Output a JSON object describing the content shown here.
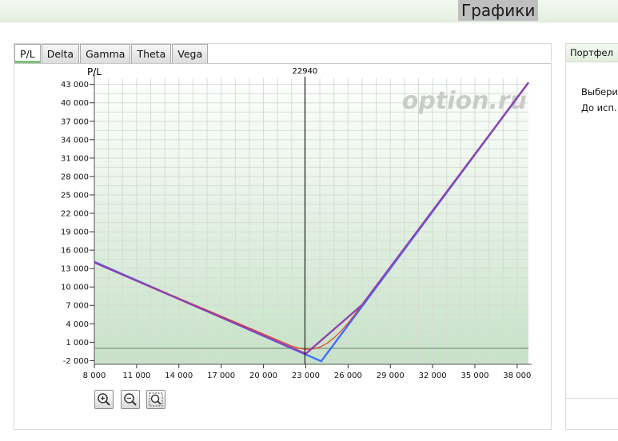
{
  "header": {
    "title": "Графики"
  },
  "tabs": [
    {
      "label": "P/L",
      "active": true
    },
    {
      "label": "Delta",
      "active": false
    },
    {
      "label": "Gamma",
      "active": false
    },
    {
      "label": "Theta",
      "active": false
    },
    {
      "label": "Vega",
      "active": false
    }
  ],
  "watermark": "option.ru",
  "zoom_buttons": [
    {
      "icon": "zoom-in-icon"
    },
    {
      "icon": "zoom-out-icon"
    },
    {
      "icon": "zoom-fit-icon"
    }
  ],
  "right_panel": {
    "header": "Портфел",
    "lines": [
      "Выбери",
      "До исп."
    ]
  },
  "colors": {
    "expiry_line": "#3f6fff",
    "today_line": "#8e44ad",
    "today_curve": "#e63b1f",
    "zero_line": "#7b8f7b",
    "marker_line": "#000000"
  },
  "chart_data": {
    "type": "line",
    "ylabel": "P/L",
    "marker": {
      "x": 22940,
      "label": "22940"
    },
    "xlim": [
      8000,
      38800
    ],
    "ylim": [
      -2600,
      44000
    ],
    "x_ticks": [
      8000,
      11000,
      14000,
      17000,
      20000,
      23000,
      26000,
      29000,
      32000,
      35000,
      38000
    ],
    "x_tick_labels": [
      "8 000",
      "11 000",
      "14 000",
      "17 000",
      "20 000",
      "23 000",
      "26 000",
      "29 000",
      "32 000",
      "35 000",
      "38 000"
    ],
    "y_ticks": [
      -2000,
      1000,
      4000,
      7000,
      10000,
      13000,
      16000,
      19000,
      22000,
      25000,
      28000,
      31000,
      34000,
      37000,
      40000,
      43000
    ],
    "y_tick_labels": [
      "-2 000",
      "1 000",
      "4 000",
      "7 000",
      "10 000",
      "13 000",
      "16 000",
      "19 000",
      "22 000",
      "25 000",
      "28 000",
      "31 000",
      "34 000",
      "37 000",
      "40 000",
      "43 000"
    ],
    "series": [
      {
        "x": [
          8000,
          24100,
          38800
        ],
        "y": [
          14100,
          -2100,
          43300
        ]
      },
      {
        "x": [
          8000,
          22000,
          22500,
          23000,
          23500,
          24000,
          24500,
          25000,
          25500,
          26000,
          27000,
          38800
        ],
        "y": [
          14000,
          400,
          20,
          -150,
          -100,
          200,
          800,
          1700,
          2800,
          4100,
          7100,
          43300
        ]
      },
      {
        "x": [
          8000,
          23000,
          27000,
          38800
        ],
        "y": [
          14000,
          -900,
          7100,
          43300
        ]
      }
    ]
  }
}
